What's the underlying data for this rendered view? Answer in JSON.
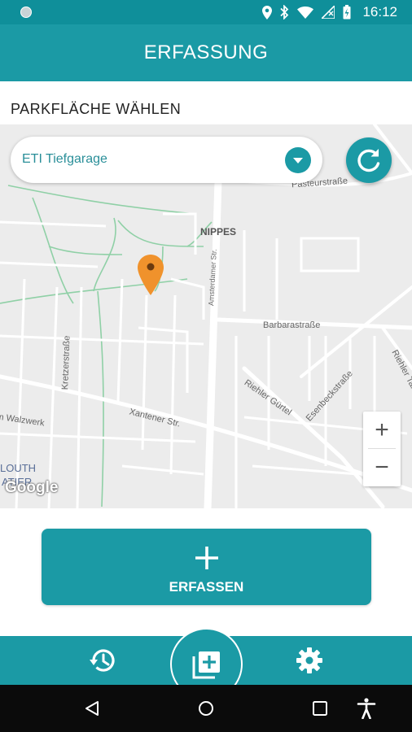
{
  "status_bar": {
    "time": "16:12",
    "icons": [
      "location-icon",
      "bluetooth-icon",
      "wifi-icon",
      "no-signal-icon",
      "battery-charging-icon"
    ]
  },
  "app_bar": {
    "title": "ERFASSUNG"
  },
  "section": {
    "label": "PARKFLÄCHE WÄHLEN"
  },
  "selector": {
    "selected_value": "ETI Tiefgarage"
  },
  "map": {
    "labels": {
      "nippes": "NIPPES",
      "pasteurstrasse": "Pasteurstraße",
      "amsterdamer": "Amsterdamer Str.",
      "barbarastrasse": "Barbarastraße",
      "kretzerstrasse": "Kretzerstraße",
      "walzwerk": "Am Walzwerk",
      "xantener": "Xantener Str.",
      "riehler_guertel": "Riehler Gürtel",
      "esenbeckstrasse": "Esenbeckstraße",
      "riehler_tal": "Riehler Tal",
      "louth": "LOUTH",
      "atier": "ATIER"
    },
    "zoom_in": "+",
    "zoom_out": "−",
    "attribution": "Google"
  },
  "action_button": {
    "label": "ERFASSEN"
  },
  "colors": {
    "primary": "#1b9aa5",
    "status_bar": "#0f8f9a",
    "marker": "#f0922c"
  }
}
